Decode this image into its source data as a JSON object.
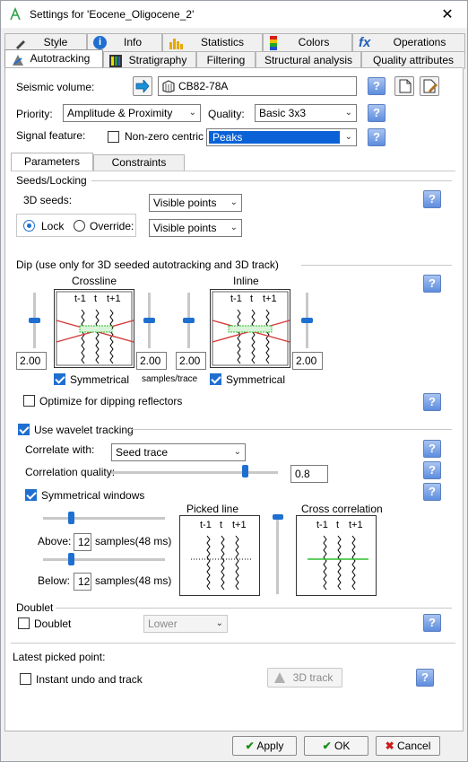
{
  "window": {
    "title": "Settings for 'Eocene_Oligocene_2'"
  },
  "tabs_row1": [
    "Style",
    "Info",
    "Statistics",
    "Colors",
    "Operations"
  ],
  "tabs_row2": [
    "Autotracking",
    "Stratigraphy",
    "Filtering",
    "Structural analysis",
    "Quality attributes"
  ],
  "seismic": {
    "label": "Seismic volume:",
    "value": "CB82-78A"
  },
  "priority": {
    "label": "Priority:",
    "value": "Amplitude & Proximity"
  },
  "quality": {
    "label": "Quality:",
    "value": "Basic 3x3"
  },
  "signal": {
    "label": "Signal feature:",
    "nonzero_label": "Non-zero centric",
    "value": "Peaks"
  },
  "inner_tabs": [
    "Parameters",
    "Constraints"
  ],
  "seeds": {
    "section": "Seeds/Locking",
    "label_3d": "3D seeds:",
    "value_3d": "Visible points",
    "lock_label": "Lock",
    "override_label": "Override:",
    "override_value": "Visible points"
  },
  "dip": {
    "section": "Dip (use only for 3D seeded autotracking and 3D track)",
    "crossline_label": "Crossline",
    "inline_label": "Inline",
    "trace_labels": [
      "t-1",
      "t",
      "t+1"
    ],
    "values": [
      "2.00",
      "2.00",
      "2.00",
      "2.00"
    ],
    "slider_levels": [
      0.5,
      0.5,
      0.5,
      0.5
    ],
    "symmetrical": "Symmetrical",
    "units": "samples/trace",
    "optimize_label": "Optimize for dipping reflectors"
  },
  "wavelet": {
    "label": "Use wavelet tracking",
    "correlate_label": "Correlate with:",
    "correlate_value": "Seed trace",
    "quality_label": "Correlation quality:",
    "quality_value": "0.8",
    "quality_level": 0.8,
    "symmetrical_windows": "Symmetrical windows",
    "picked_line": "Picked line",
    "cross_correlation": "Cross correlation",
    "above_label": "Above:",
    "above_value": "12",
    "above_units": "samples(48 ms)",
    "below_label": "Below:",
    "below_value": "12",
    "below_units": "samples(48 ms)"
  },
  "doublet": {
    "section": "Doublet",
    "label": "Doublet",
    "value": "Lower"
  },
  "latest": {
    "section": "Latest picked point:",
    "instant_label": "Instant undo and track",
    "track_button": "3D track"
  },
  "buttons": {
    "apply": "Apply",
    "ok": "OK",
    "cancel": "Cancel"
  },
  "icons": {
    "help": "?",
    "close": "✕"
  },
  "colors": {
    "accent": "#1f6fd1",
    "selection": "#0a62d6",
    "ok_check": "#1a8f1a",
    "cancel_x": "#cc1a1a",
    "tracks_red": "#d43c3c",
    "tracks_green": "#2fbf2f"
  }
}
